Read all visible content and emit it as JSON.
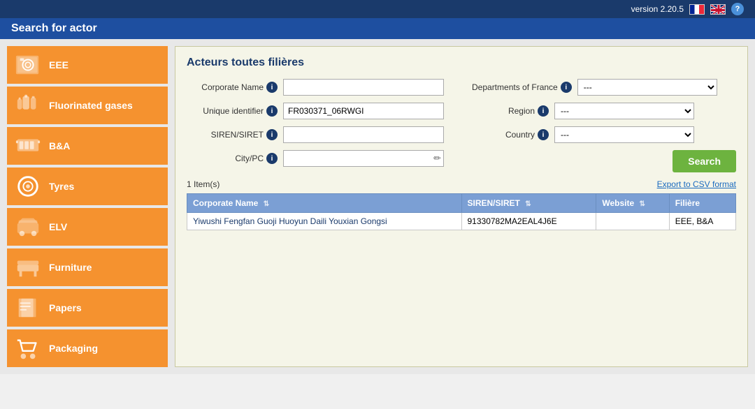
{
  "version": {
    "label": "version 2.20.5"
  },
  "top_bar": {
    "title": "Search for actor"
  },
  "sidebar": {
    "items": [
      {
        "id": "eee",
        "label": "EEE",
        "icon": "washing-machine"
      },
      {
        "id": "fluorinated-gases",
        "label": "Fluorinated gases",
        "icon": "gas-tank"
      },
      {
        "id": "ba",
        "label": "B&A",
        "icon": "battery"
      },
      {
        "id": "tyres",
        "label": "Tyres",
        "icon": "tyre"
      },
      {
        "id": "elv",
        "label": "ELV",
        "icon": "car-seat"
      },
      {
        "id": "furniture",
        "label": "Furniture",
        "icon": "furniture"
      },
      {
        "id": "papers",
        "label": "Papers",
        "icon": "paper"
      },
      {
        "id": "packaging",
        "label": "Packaging",
        "icon": "packaging"
      }
    ]
  },
  "content": {
    "title": "Acteurs toutes filières",
    "form": {
      "corporate_name_label": "Corporate Name",
      "unique_identifier_label": "Unique identifier",
      "siren_siret_label": "SIREN/SIRET",
      "city_pc_label": "City/PC",
      "departments_france_label": "Departments of France",
      "region_label": "Region",
      "country_label": "Country",
      "corporate_name_value": "",
      "unique_identifier_value": "FR030371_06RWGI",
      "siren_siret_value": "",
      "city_pc_value": "",
      "departments_france_value": "---",
      "region_value": "---",
      "country_value": "---",
      "search_button_label": "Search",
      "export_link_label": "Export to CSV format"
    },
    "results": {
      "count_label": "1 Item(s)",
      "table": {
        "columns": [
          {
            "key": "corporate_name",
            "label": "Corporate Name"
          },
          {
            "key": "siren_siret",
            "label": "SIREN/SIRET"
          },
          {
            "key": "website",
            "label": "Website"
          },
          {
            "key": "filiere",
            "label": "Filière"
          }
        ],
        "rows": [
          {
            "corporate_name": "Yiwushi Fengfan Guoji Huoyun Daili Youxian Gongsi",
            "siren_siret": "91330782MA2EAL4J6E",
            "website": "",
            "filiere": "EEE, B&A"
          }
        ]
      }
    }
  }
}
